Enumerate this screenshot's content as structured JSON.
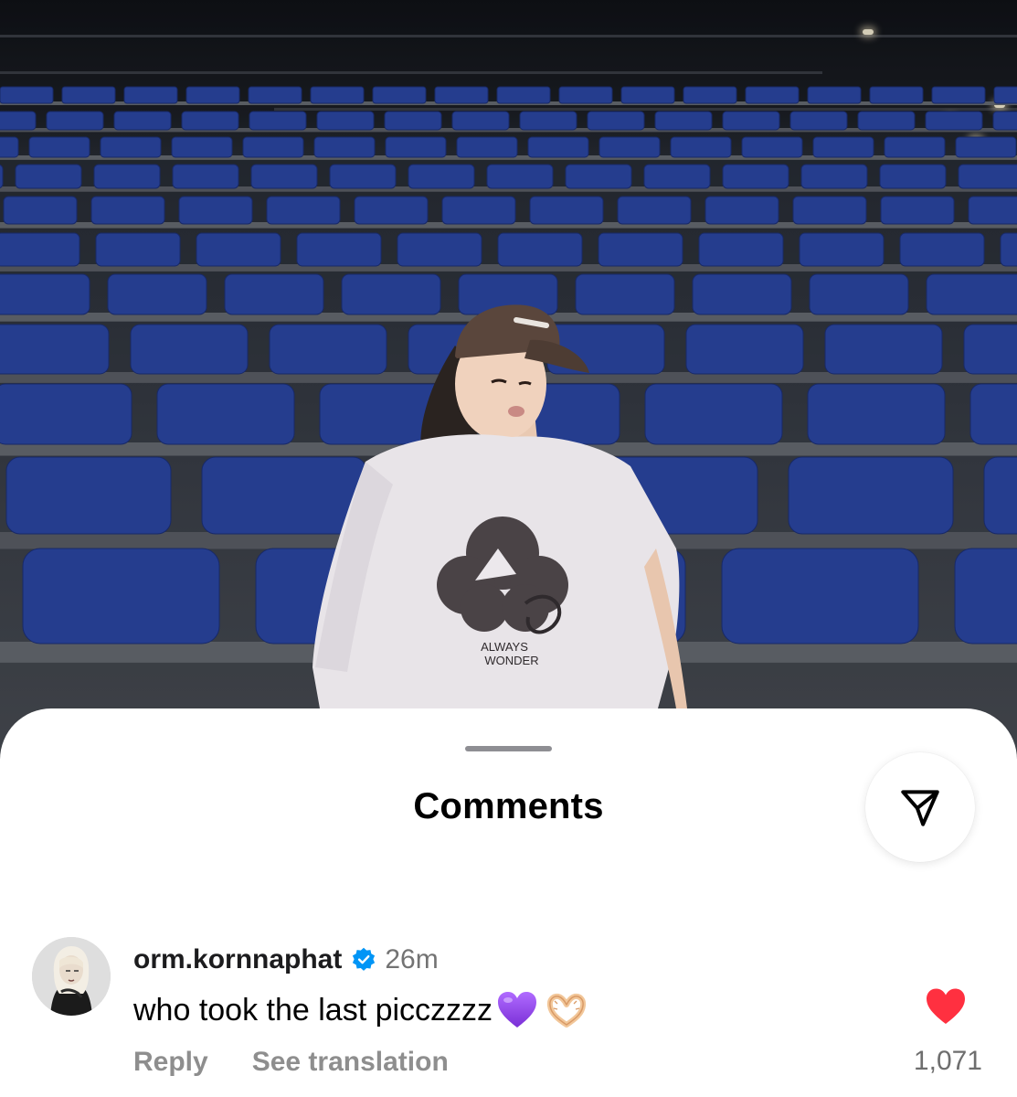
{
  "sheet": {
    "title": "Comments"
  },
  "share_icon": "paper-plane-icon",
  "comment": {
    "username": "orm.kornnaphat",
    "verified": true,
    "timestamp": "26m",
    "text": "who took the last picczzzz",
    "emojis": [
      "purple-heart-emoji",
      "heart-hands-emoji"
    ],
    "reply_label": "Reply",
    "translate_label": "See translation",
    "like_count": "1,071",
    "liked": true
  },
  "colors": {
    "like_red": "#ff3040",
    "verified_blue": "#0095f6",
    "seat_blue": "#2b47a8",
    "purple_heart": "#9b4dff"
  },
  "photo": {
    "shirt_text": [
      "ALWAYS",
      "WONDER"
    ]
  }
}
